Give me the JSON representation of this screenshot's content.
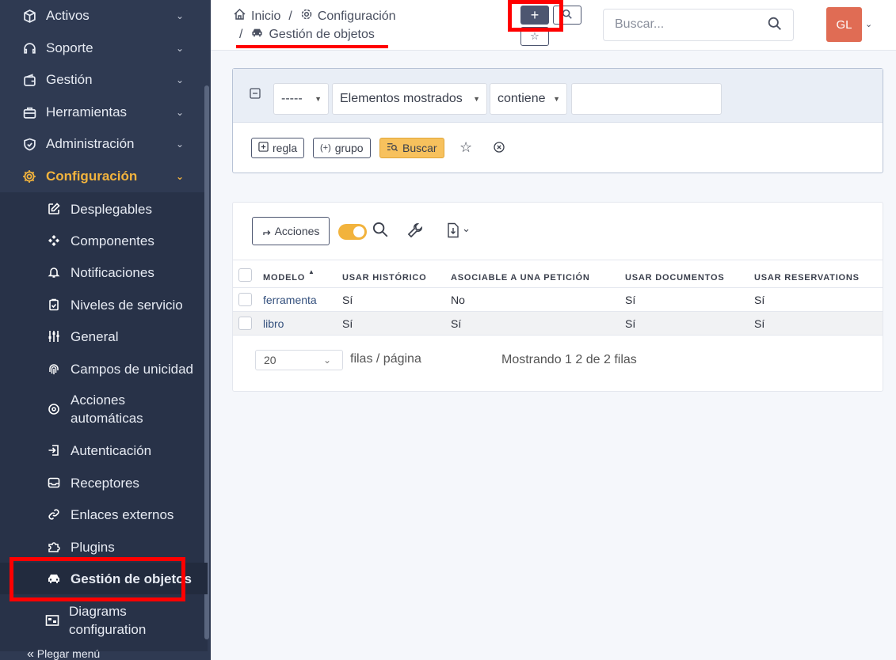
{
  "sidebar": {
    "items": [
      {
        "label": "Activos",
        "icon": "cube-icon"
      },
      {
        "label": "Soporte",
        "icon": "headset-icon"
      },
      {
        "label": "Gestión",
        "icon": "wallet-icon"
      },
      {
        "label": "Herramientas",
        "icon": "briefcase-icon"
      },
      {
        "label": "Administración",
        "icon": "shield-icon"
      },
      {
        "label": "Configuración",
        "icon": "gear-icon"
      }
    ],
    "subitems": [
      {
        "label": "Desplegables",
        "icon": "edit-icon"
      },
      {
        "label": "Componentes",
        "icon": "components-icon"
      },
      {
        "label": "Notificaciones",
        "icon": "bell-icon"
      },
      {
        "label": "Niveles de servicio",
        "icon": "clipboard-check-icon"
      },
      {
        "label": "General",
        "icon": "sliders-icon"
      },
      {
        "label": "Campos de unicidad",
        "icon": "fingerprint-icon"
      },
      {
        "label": "Acciones automáticas",
        "icon": "gear-cycle-icon"
      },
      {
        "label": "Autenticación",
        "icon": "login-icon"
      },
      {
        "label": "Receptores",
        "icon": "inbox-icon"
      },
      {
        "label": "Enlaces externos",
        "icon": "link-icon"
      },
      {
        "label": "Plugins",
        "icon": "puzzle-icon"
      },
      {
        "label": "Gestión de objetos",
        "icon": "car-icon"
      },
      {
        "label": "Diagrams configuration",
        "icon": "diagram-icon"
      }
    ],
    "collapse_label": "Plegar menú"
  },
  "header": {
    "breadcrumb": {
      "home": "Inicio",
      "config": "Configuración",
      "current": "Gestión de objetos",
      "sep": "/"
    },
    "add_label": "+",
    "search_placeholder": "Buscar...",
    "avatar_initials": "GL"
  },
  "filter": {
    "field_select": "-----",
    "criteria_select": "Elementos mostrados",
    "operator_select": "contiene",
    "value": "",
    "rule_label": "regla",
    "group_label": "grupo",
    "search_label": "Buscar"
  },
  "table": {
    "actions_label": "Acciones",
    "columns": [
      "MODELO",
      "USAR HISTÓRICO",
      "ASOCIABLE A UNA PETICIÓN",
      "USAR DOCUMENTOS",
      "USAR RESERVATIONS"
    ],
    "rows": [
      [
        "ferramenta",
        "Sí",
        "No",
        "Sí",
        "Sí"
      ],
      [
        "libro",
        "Sí",
        "Sí",
        "Sí",
        "Sí"
      ]
    ],
    "page_size": "20",
    "page_size_label": "filas / página",
    "showing": "Mostrando 1 2 de 2 filas"
  },
  "colors": {
    "sidebar_bg": "#2f3a52",
    "accent": "#f2b33d",
    "highlight": "#ff0000"
  }
}
